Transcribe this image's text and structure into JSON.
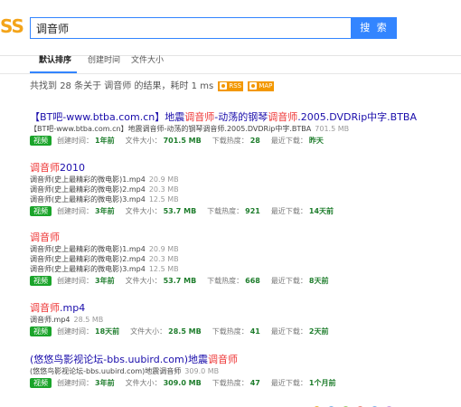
{
  "logo": {
    "text": "SS"
  },
  "search": {
    "query": "调音师",
    "button": "搜 索"
  },
  "tabs": [
    {
      "label": "默认排序",
      "active": true
    },
    {
      "label": "创建时间",
      "active": false
    },
    {
      "label": "文件大小",
      "active": false
    }
  ],
  "summary": {
    "prefix": "共找到",
    "count": "28",
    "middle": "条关于",
    "query": "调音师",
    "suffix": "的结果，耗时",
    "time": "1 ms",
    "rss": "RSS",
    "map": "MAP"
  },
  "meta_labels": {
    "created": "创建时间：",
    "size": "文件大小：",
    "heat": "下载热度：",
    "recent": "最近下载："
  },
  "results": [
    {
      "title_before": "【BT吧-www.btba.com.cn】地震",
      "title_kw": "调音师",
      "title_middle": "-动荡的钢琴",
      "title_kw2": "调音师",
      "title_after": ".2005.DVDRip中字.BTBA",
      "files": [
        {
          "name": "【BT吧-www.btba.com.cn】地震调音师-动荡的钢琴调音师.2005.DVDRip中字.BTBA",
          "size": "701.5 MB"
        }
      ],
      "badge": "视频",
      "created": "1年前",
      "size": "701.5 MB",
      "heat": "28",
      "recent": "昨天"
    },
    {
      "title_before": "",
      "title_kw": "调音师",
      "title_middle": "2010",
      "title_kw2": "",
      "title_after": "",
      "files": [
        {
          "name": "调音师(史上最精彩的微电影)1.mp4",
          "size": "20.9 MB"
        },
        {
          "name": "调音师(史上最精彩的微电影)2.mp4",
          "size": "20.3 MB"
        },
        {
          "name": "调音师(史上最精彩的微电影)3.mp4",
          "size": "12.5 MB"
        }
      ],
      "badge": "视频",
      "created": "3年前",
      "size": "53.7 MB",
      "heat": "921",
      "recent": "14天前"
    },
    {
      "title_before": "",
      "title_kw": "调音师",
      "title_middle": "",
      "title_kw2": "",
      "title_after": "",
      "files": [
        {
          "name": "调音师(史上最精彩的微电影)1.mp4",
          "size": "20.9 MB"
        },
        {
          "name": "调音师(史上最精彩的微电影)2.mp4",
          "size": "20.3 MB"
        },
        {
          "name": "调音师(史上最精彩的微电影)3.mp4",
          "size": "12.5 MB"
        }
      ],
      "badge": "视频",
      "created": "3年前",
      "size": "53.7 MB",
      "heat": "668",
      "recent": "8天前"
    },
    {
      "title_before": "",
      "title_kw": "调音师",
      "title_middle": ".mp4",
      "title_kw2": "",
      "title_after": "",
      "files": [
        {
          "name": "调音师.mp4",
          "size": "28.5 MB"
        }
      ],
      "badge": "视频",
      "created": "18天前",
      "size": "28.5 MB",
      "heat": "41",
      "recent": "2天前"
    },
    {
      "title_before": "(悠悠鸟影视论坛-bbs.uubird.com)地震",
      "title_kw": "调音师",
      "title_middle": "",
      "title_kw2": "",
      "title_after": "",
      "files": [
        {
          "name": "(悠悠鸟影视论坛-bbs.uubird.com)地震调音师",
          "size": "309.0 MB"
        }
      ],
      "badge": "视频",
      "created": "3年前",
      "size": "309.0 MB",
      "heat": "47",
      "recent": "1个月前"
    }
  ],
  "colors": {
    "accent": "#3385ff",
    "keyword": "#ee3333",
    "link": "#1a0dab",
    "badge": "#1aa42a",
    "value": "#1e7d2c",
    "logo": "#f3a41a"
  }
}
